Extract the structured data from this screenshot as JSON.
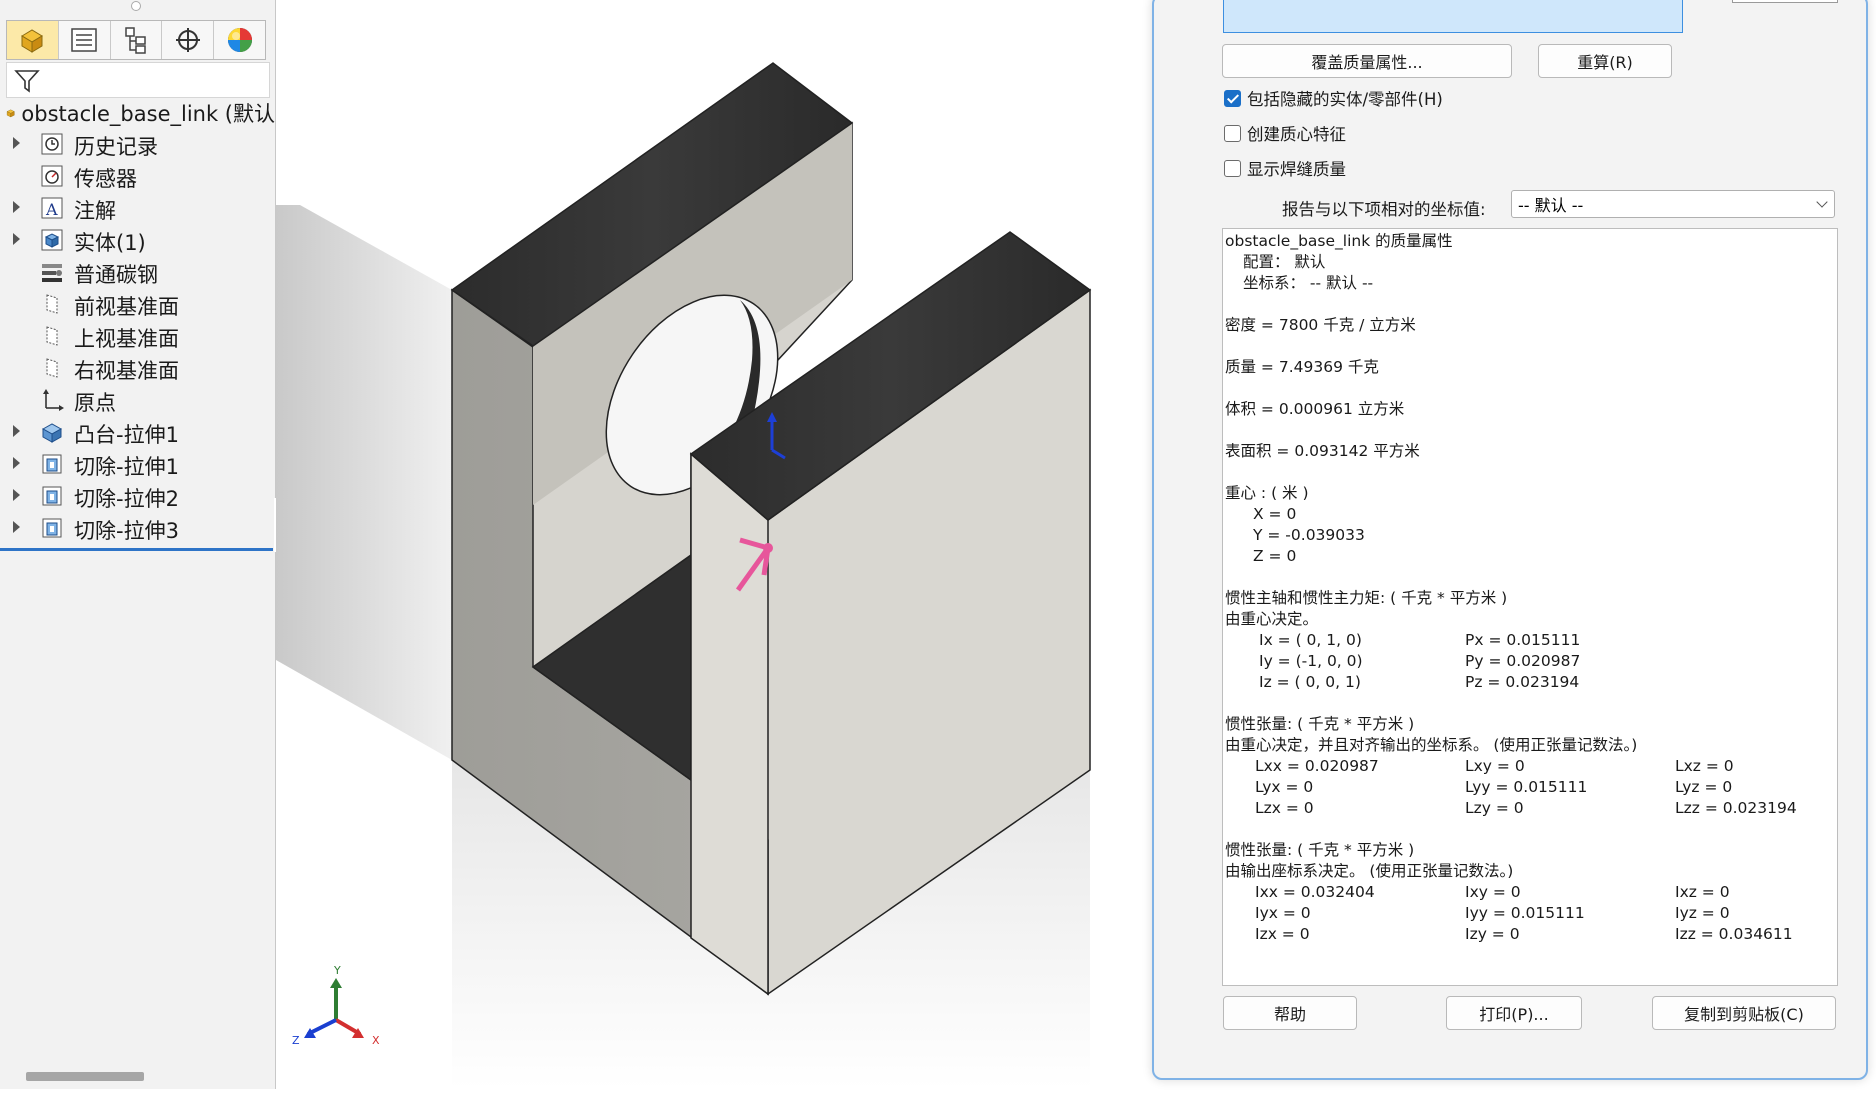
{
  "feature_tree": {
    "root": "obstacle_base_link (默认",
    "items": [
      {
        "label": "历史记录",
        "expandable": true,
        "icon": "history-icon"
      },
      {
        "label": "传感器",
        "expandable": false,
        "icon": "sensor-icon"
      },
      {
        "label": "注解",
        "expandable": true,
        "icon": "annotation-icon"
      },
      {
        "label": "实体(1)",
        "expandable": true,
        "icon": "solid-body-icon"
      },
      {
        "label": "普通碳钢",
        "expandable": false,
        "icon": "material-icon"
      },
      {
        "label": "前视基准面",
        "expandable": false,
        "icon": "plane-icon"
      },
      {
        "label": "上视基准面",
        "expandable": false,
        "icon": "plane-icon"
      },
      {
        "label": "右视基准面",
        "expandable": false,
        "icon": "plane-icon"
      },
      {
        "label": "原点",
        "expandable": false,
        "icon": "origin-icon"
      },
      {
        "label": "凸台-拉伸1",
        "expandable": true,
        "icon": "boss-extrude-icon"
      },
      {
        "label": "切除-拉伸1",
        "expandable": true,
        "icon": "cut-extrude-icon"
      },
      {
        "label": "切除-拉伸2",
        "expandable": true,
        "icon": "cut-extrude-icon"
      },
      {
        "label": "切除-拉伸3",
        "expandable": true,
        "icon": "cut-extrude-icon"
      }
    ]
  },
  "triad": {
    "x": "X",
    "y": "Y",
    "z": "Z"
  },
  "dialog": {
    "override_button": "覆盖质量属性...",
    "recalc_button": "重算(R)",
    "include_hidden": {
      "label": "包括隐藏的实体/零部件(H)",
      "checked": true
    },
    "create_com": {
      "label": "创建质心特征",
      "checked": false
    },
    "show_weld": {
      "label": "显示焊缝质量",
      "checked": false
    },
    "coord_label": "报告与以下项相对的坐标值:",
    "coord_value": "-- 默认 --",
    "help_button": "帮助",
    "print_button": "打印(P)...",
    "copy_button": "复制到剪贴板(C)"
  },
  "results": {
    "title": "obstacle_base_link 的质量属性",
    "config": "配置： 默认",
    "coord_sys": "坐标系： -- 默认 --",
    "density": "密度 = 7800 千克 / 立方米",
    "mass": "质量 = 7.49369 千克",
    "volume": "体积 = 0.000961 立方米",
    "area": "表面积 = 0.093142 平方米",
    "com_title": "重心 : ( 米 )",
    "com_x": "X = 0",
    "com_y": "Y = -0.039033",
    "com_z": "Z = 0",
    "principal_title": "惯性主轴和惯性主力矩: ( 千克 * 平方米 )",
    "principal_sub": "由重心决定。",
    "ix": "Ix = ( 0,  1,  0)",
    "iy": "Iy = (-1,  0,  0)",
    "iz": "Iz = ( 0,  0,  1)",
    "px": "Px = 0.015111",
    "py": "Py = 0.020987",
    "pz": "Pz = 0.023194",
    "tensor1_title": "惯性张量: ( 千克 * 平方米 )",
    "tensor1_sub": "由重心决定，并且对齐输出的坐标系。 (使用正张量记数法。)",
    "lxx": "Lxx = 0.020987",
    "lxy": "Lxy = 0",
    "lxz": "Lxz = 0",
    "lyx": "Lyx = 0",
    "lyy": "Lyy = 0.015111",
    "lyz": "Lyz = 0",
    "lzx": "Lzx = 0",
    "lzy": "Lzy = 0",
    "lzz": "Lzz = 0.023194",
    "tensor2_title": "惯性张量: ( 千克 * 平方米 )",
    "tensor2_sub": "由输出座标系决定。 (使用正张量记数法。)",
    "ixx": "Ixx = 0.032404",
    "ixy": "Ixy = 0",
    "ixz": "Ixz = 0",
    "iyx": "Iyx = 0",
    "iyy": "Iyy = 0.015111",
    "iyz": "Iyz = 0",
    "izx": "Izx = 0",
    "izy": "Izy = 0",
    "izz": "Izz = 0.034611"
  }
}
